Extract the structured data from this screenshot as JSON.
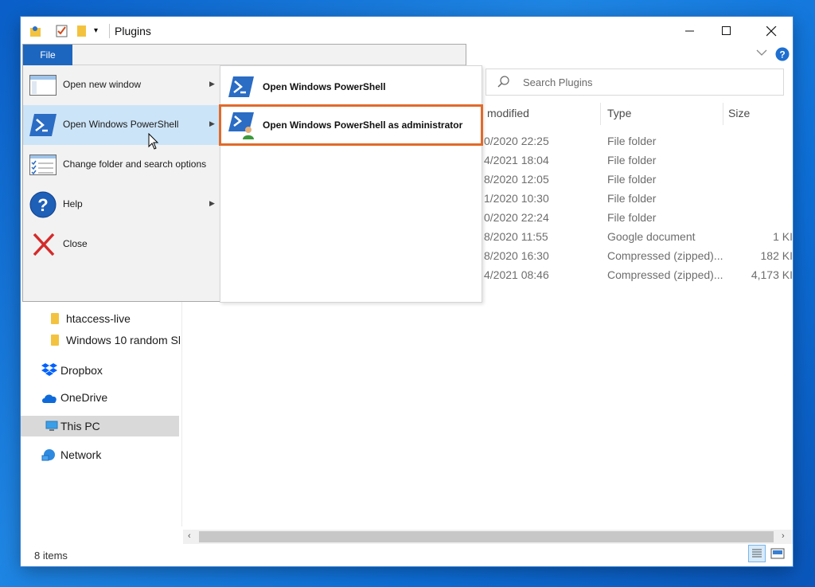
{
  "window": {
    "title": "Plugins"
  },
  "search": {
    "placeholder": "Search Plugins"
  },
  "columns": {
    "modified": "modified",
    "type": "Type",
    "size": "Size"
  },
  "rows": [
    {
      "date": "0/2020 22:25",
      "type": "File folder",
      "size": ""
    },
    {
      "date": "4/2021 18:04",
      "type": "File folder",
      "size": ""
    },
    {
      "date": "8/2020 12:05",
      "type": "File folder",
      "size": ""
    },
    {
      "date": "1/2020 10:30",
      "type": "File folder",
      "size": ""
    },
    {
      "date": "0/2020 22:24",
      "type": "File folder",
      "size": ""
    },
    {
      "date": "8/2020 11:55",
      "type": "Google document",
      "size": "1 KI"
    },
    {
      "date": "8/2020 16:30",
      "type": "Compressed (zipped)...",
      "size": "182 KI"
    },
    {
      "date": "4/2021 08:46",
      "type": "Compressed (zipped)...",
      "size": "4,173 KI"
    }
  ],
  "nav": {
    "htaccess": "htaccess-live",
    "win10": "Windows 10 random Sh",
    "dropbox": "Dropbox",
    "onedrive": "OneDrive",
    "thispc": "This PC",
    "network": "Network"
  },
  "file_menu": {
    "tab": "File",
    "items": {
      "new_window": "Open new window",
      "powershell": "Open Windows PowerShell",
      "options": "Change folder and search options",
      "help": "Help",
      "close": "Close"
    },
    "submenu": {
      "open_ps": "Open Windows PowerShell",
      "open_ps_admin": "Open Windows PowerShell as administrator"
    }
  },
  "status": {
    "items": "8 items"
  },
  "icons": [
    "person-folder-icon",
    "checkmark-icon",
    "folder-icon",
    "dropdown-icon",
    "minimize-icon",
    "maximize-icon",
    "close-icon",
    "chevron-down-icon",
    "help-icon",
    "search-icon",
    "powershell-icon",
    "powershell-admin-icon",
    "window-icon",
    "options-icon",
    "help-circle-icon",
    "close-x-icon",
    "dropbox-icon",
    "onedrive-icon",
    "this-pc-icon",
    "network-icon",
    "details-view-icon",
    "large-icons-view-icon",
    "mouse-cursor-icon"
  ],
  "colors": {
    "accent": "#1d66bf",
    "highlight": "#cce4f7",
    "admin_outline": "#e16a2a"
  }
}
